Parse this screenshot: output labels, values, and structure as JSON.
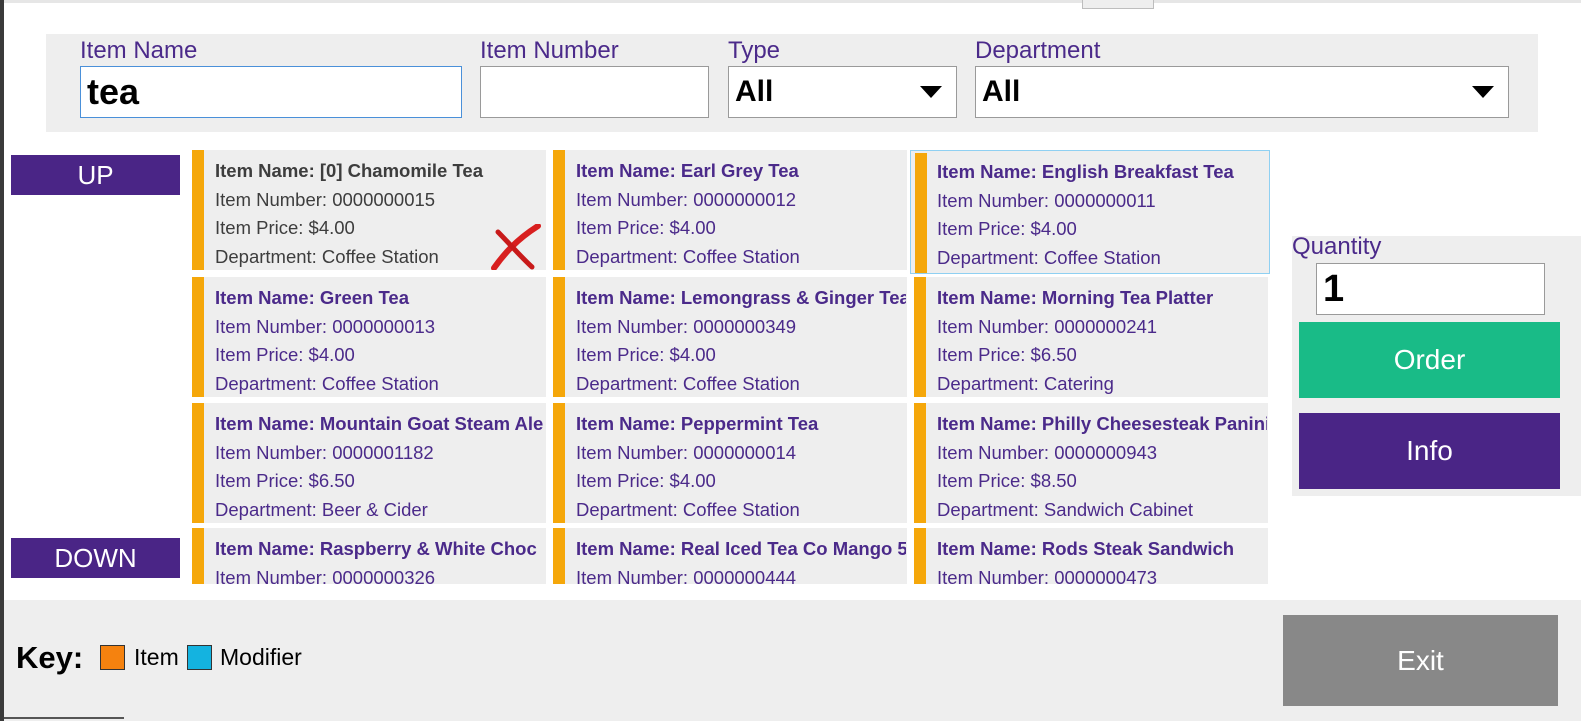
{
  "filters": {
    "item_name_label": "Item Name",
    "item_name_value": "tea",
    "item_number_label": "Item Number",
    "item_number_value": "",
    "type_label": "Type",
    "type_value": "All",
    "department_label": "Department",
    "department_value": "All"
  },
  "nav": {
    "up_label": "UP",
    "down_label": "DOWN"
  },
  "tiles": [
    {
      "name": "Item Name: [0] Chamomile Tea",
      "number": "Item Number: 0000000015",
      "price": "Item Price: $4.00",
      "department": "Department: Coffee Station"
    },
    {
      "name": "Item Name: Earl Grey Tea",
      "number": "Item Number: 0000000012",
      "price": "Item Price: $4.00",
      "department": "Department: Coffee Station"
    },
    {
      "name": "Item Name: English Breakfast Tea",
      "number": "Item Number: 0000000011",
      "price": "Item Price: $4.00",
      "department": "Department: Coffee Station"
    },
    {
      "name": "Item Name: Green Tea",
      "number": "Item Number: 0000000013",
      "price": "Item Price: $4.00",
      "department": "Department: Coffee Station"
    },
    {
      "name": "Item Name: Lemongrass & Ginger Tea",
      "number": "Item Number: 0000000349",
      "price": "Item Price: $4.00",
      "department": "Department: Coffee Station"
    },
    {
      "name": "Item Name: Morning Tea Platter",
      "number": "Item Number: 0000000241",
      "price": "Item Price: $6.50",
      "department": "Department: Catering"
    },
    {
      "name": "Item Name: Mountain Goat Steam Ale",
      "number": "Item Number: 0000001182",
      "price": "Item Price: $6.50",
      "department": "Department: Beer & Cider"
    },
    {
      "name": "Item Name: Peppermint Tea",
      "number": "Item Number: 0000000014",
      "price": "Item Price: $4.00",
      "department": "Department: Coffee Station"
    },
    {
      "name": "Item Name: Philly Cheesesteak Panini",
      "number": "Item Number: 0000000943",
      "price": "Item Price: $8.50",
      "department": "Department: Sandwich Cabinet"
    },
    {
      "name": "Item Name: Raspberry & White Choc",
      "number": "Item Number: 0000000326",
      "price": "",
      "department": ""
    },
    {
      "name": "Item Name: Real Iced Tea Co Mango 5",
      "number": "Item Number: 0000000444",
      "price": "",
      "department": ""
    },
    {
      "name": "Item Name: Rods Steak Sandwich",
      "number": "Item Number: 0000000473",
      "price": "",
      "department": ""
    }
  ],
  "order_panel": {
    "quantity_label": "Quantity",
    "quantity_value": "1",
    "order_label": "Order",
    "info_label": "Info"
  },
  "footer": {
    "key_label": "Key:",
    "item_key": "Item",
    "modifier_key": "Modifier",
    "exit_label": "Exit"
  },
  "colors": {
    "accent_purple": "#4a2586",
    "item_orange": "#f5a70a",
    "modifier_blue": "#14b3e0",
    "order_green": "#19bb87",
    "exit_gray": "#888888"
  },
  "icons": {
    "unavailable_mark": "red-x-icon"
  }
}
